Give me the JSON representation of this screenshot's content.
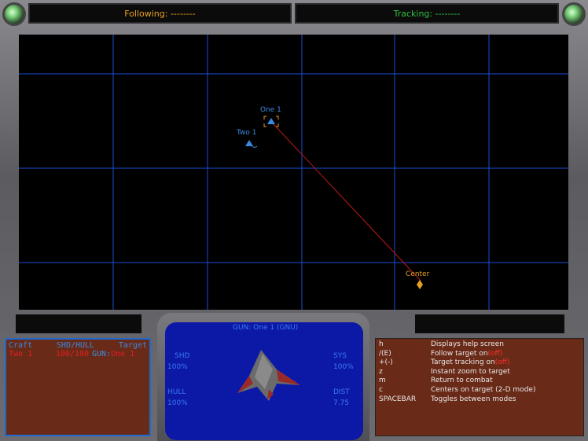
{
  "header": {
    "following": "Following: --------",
    "tracking": "Tracking: --------"
  },
  "map": {
    "grid_color": "#1c4ed8",
    "ships": [
      {
        "label": "One 1",
        "color": "#3a8ae0"
      },
      {
        "label": "Two 1",
        "color": "#3a8ae0"
      },
      {
        "label": "Center",
        "color": "#e8a020"
      }
    ],
    "track_line_color": "#c01818"
  },
  "craft_panel": {
    "col_craft": "Craft",
    "col_shd_hull": "SHD/HULL",
    "col_target": "Target",
    "rows": [
      {
        "craft": "Two 1",
        "shd_hull": "100/100",
        "target_prefix": "GUN:",
        "target": "One 1"
      }
    ]
  },
  "viewer": {
    "title": "GUN: One 1 (GNU)",
    "shd_label": "SHD",
    "shd_value": "100%",
    "hull_label": "HULL",
    "hull_value": "100%",
    "sys_label": "SYS",
    "sys_value": "100%",
    "dist_label": "DIST",
    "dist_value": "7.75"
  },
  "help": [
    {
      "key": "h",
      "desc": "Displays help screen"
    },
    {
      "key": "/(E)",
      "desc": "Follow target on",
      "state": "(off)"
    },
    {
      "key": "+(-)",
      "desc": "Target tracking on",
      "state": "(off)"
    },
    {
      "key": "z",
      "desc": "Instant zoom to target"
    },
    {
      "key": "m",
      "desc": "Return to combat"
    },
    {
      "key": "c",
      "desc": "Centers on target (2-D mode)"
    },
    {
      "key": "SPACEBAR",
      "desc": "Toggles between modes"
    }
  ]
}
